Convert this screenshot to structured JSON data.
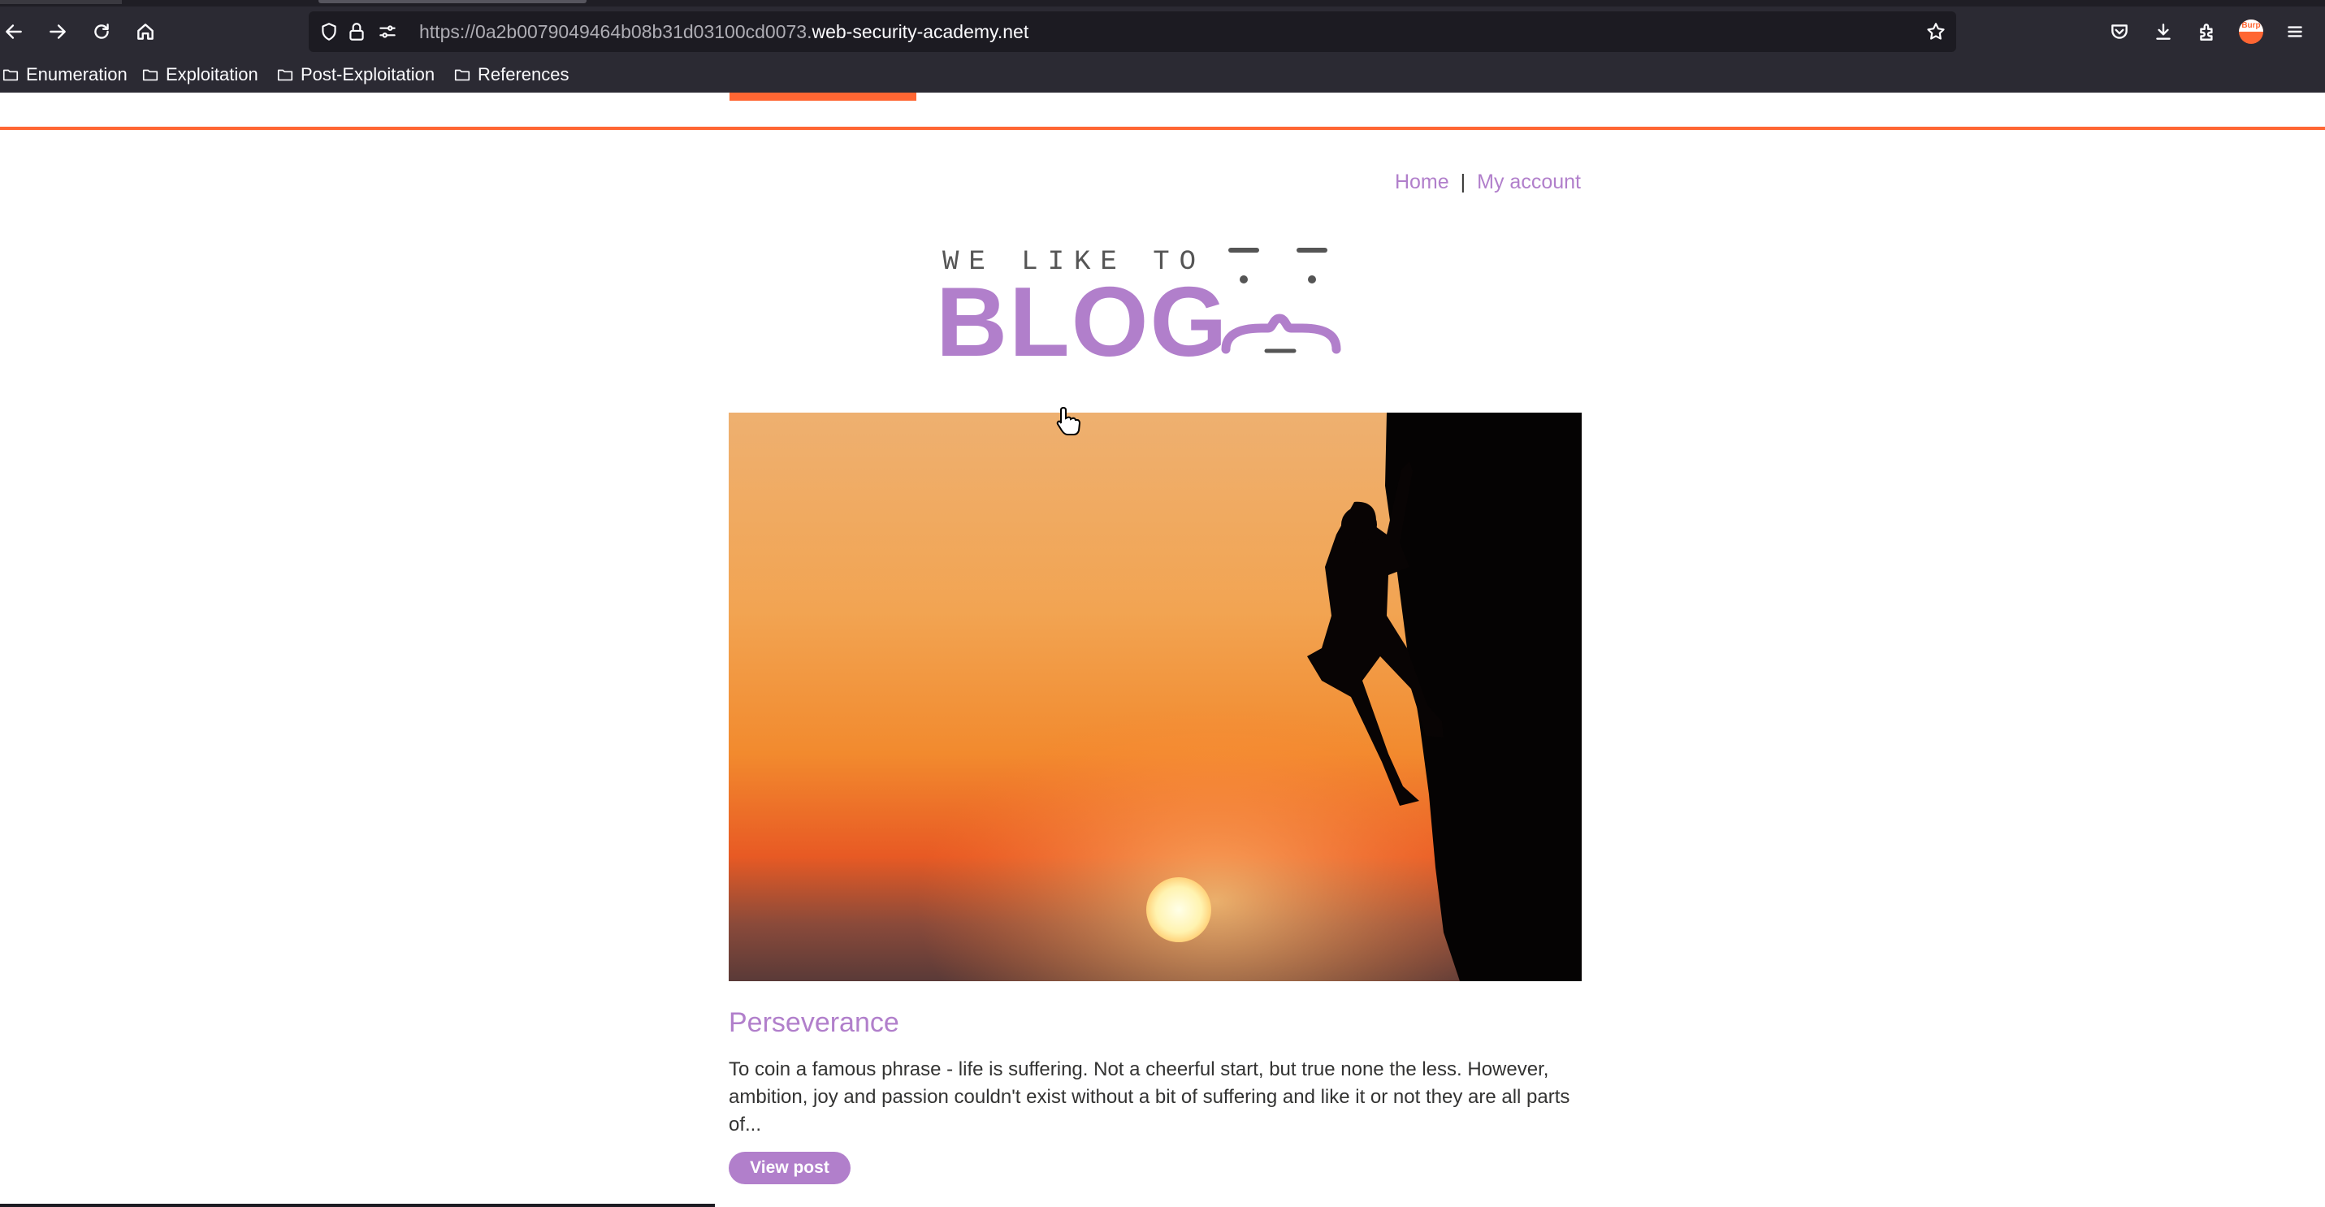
{
  "browser": {
    "url_prefix": "https://0a2b0079049464b08b31d03100cd0073.",
    "url_domain": "web-security-academy.net",
    "extension_badge": "Burp",
    "bookmarks": [
      {
        "label": "Enumeration"
      },
      {
        "label": "Exploitation"
      },
      {
        "label": "Post-Exploitation"
      },
      {
        "label": "References"
      }
    ]
  },
  "nav": {
    "home": "Home",
    "separator": "|",
    "account": "My account"
  },
  "logo": {
    "tagline": "WE LIKE TO",
    "word": "BLOG"
  },
  "post": {
    "title": "Perseverance",
    "summary": "To coin a famous phrase - life is suffering. Not a cheerful start, but true none the less. However, ambition, joy and passion couldn't exist without a bit of suffering and like it or not they are all parts of...",
    "button": "View post"
  },
  "colors": {
    "accent_purple": "#b17fcb",
    "accent_orange": "#ff6633",
    "chrome_dark": "#2b2a33"
  }
}
